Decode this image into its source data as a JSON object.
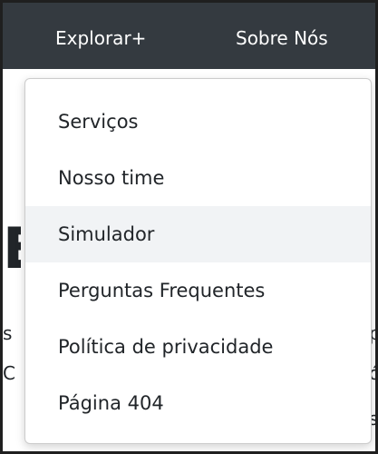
{
  "navbar": {
    "explorar": "Explorar+",
    "sobre": "Sobre Nós"
  },
  "dropdown": {
    "items": [
      {
        "label": "Serviços"
      },
      {
        "label": "Nosso time"
      },
      {
        "label": "Simulador"
      },
      {
        "label": "Perguntas Frequentes"
      },
      {
        "label": "Política de privacidade"
      },
      {
        "label": "Página 404"
      }
    ],
    "highlighted_index": 2
  },
  "background": {
    "heading_fragment": "E",
    "left_fragment_1": "s",
    "left_fragment_2": "C",
    "right_fragment_1": "p",
    "right_fragment_2": "ó",
    "right_fragment_3": "s"
  },
  "colors": {
    "navbar_bg": "#343a40",
    "dropdown_hover": "#f1f3f5"
  }
}
